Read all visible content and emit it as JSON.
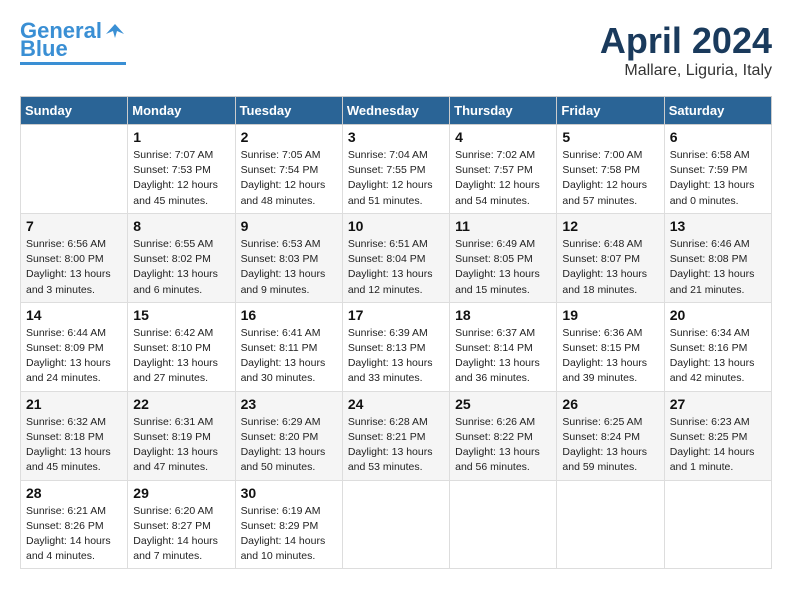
{
  "header": {
    "logo_line1": "General",
    "logo_line2": "Blue",
    "title": "April 2024",
    "subtitle": "Mallare, Liguria, Italy"
  },
  "columns": [
    "Sunday",
    "Monday",
    "Tuesday",
    "Wednesday",
    "Thursday",
    "Friday",
    "Saturday"
  ],
  "weeks": [
    [
      {
        "day": "",
        "info": ""
      },
      {
        "day": "1",
        "info": "Sunrise: 7:07 AM\nSunset: 7:53 PM\nDaylight: 12 hours\nand 45 minutes."
      },
      {
        "day": "2",
        "info": "Sunrise: 7:05 AM\nSunset: 7:54 PM\nDaylight: 12 hours\nand 48 minutes."
      },
      {
        "day": "3",
        "info": "Sunrise: 7:04 AM\nSunset: 7:55 PM\nDaylight: 12 hours\nand 51 minutes."
      },
      {
        "day": "4",
        "info": "Sunrise: 7:02 AM\nSunset: 7:57 PM\nDaylight: 12 hours\nand 54 minutes."
      },
      {
        "day": "5",
        "info": "Sunrise: 7:00 AM\nSunset: 7:58 PM\nDaylight: 12 hours\nand 57 minutes."
      },
      {
        "day": "6",
        "info": "Sunrise: 6:58 AM\nSunset: 7:59 PM\nDaylight: 13 hours\nand 0 minutes."
      }
    ],
    [
      {
        "day": "7",
        "info": "Sunrise: 6:56 AM\nSunset: 8:00 PM\nDaylight: 13 hours\nand 3 minutes."
      },
      {
        "day": "8",
        "info": "Sunrise: 6:55 AM\nSunset: 8:02 PM\nDaylight: 13 hours\nand 6 minutes."
      },
      {
        "day": "9",
        "info": "Sunrise: 6:53 AM\nSunset: 8:03 PM\nDaylight: 13 hours\nand 9 minutes."
      },
      {
        "day": "10",
        "info": "Sunrise: 6:51 AM\nSunset: 8:04 PM\nDaylight: 13 hours\nand 12 minutes."
      },
      {
        "day": "11",
        "info": "Sunrise: 6:49 AM\nSunset: 8:05 PM\nDaylight: 13 hours\nand 15 minutes."
      },
      {
        "day": "12",
        "info": "Sunrise: 6:48 AM\nSunset: 8:07 PM\nDaylight: 13 hours\nand 18 minutes."
      },
      {
        "day": "13",
        "info": "Sunrise: 6:46 AM\nSunset: 8:08 PM\nDaylight: 13 hours\nand 21 minutes."
      }
    ],
    [
      {
        "day": "14",
        "info": "Sunrise: 6:44 AM\nSunset: 8:09 PM\nDaylight: 13 hours\nand 24 minutes."
      },
      {
        "day": "15",
        "info": "Sunrise: 6:42 AM\nSunset: 8:10 PM\nDaylight: 13 hours\nand 27 minutes."
      },
      {
        "day": "16",
        "info": "Sunrise: 6:41 AM\nSunset: 8:11 PM\nDaylight: 13 hours\nand 30 minutes."
      },
      {
        "day": "17",
        "info": "Sunrise: 6:39 AM\nSunset: 8:13 PM\nDaylight: 13 hours\nand 33 minutes."
      },
      {
        "day": "18",
        "info": "Sunrise: 6:37 AM\nSunset: 8:14 PM\nDaylight: 13 hours\nand 36 minutes."
      },
      {
        "day": "19",
        "info": "Sunrise: 6:36 AM\nSunset: 8:15 PM\nDaylight: 13 hours\nand 39 minutes."
      },
      {
        "day": "20",
        "info": "Sunrise: 6:34 AM\nSunset: 8:16 PM\nDaylight: 13 hours\nand 42 minutes."
      }
    ],
    [
      {
        "day": "21",
        "info": "Sunrise: 6:32 AM\nSunset: 8:18 PM\nDaylight: 13 hours\nand 45 minutes."
      },
      {
        "day": "22",
        "info": "Sunrise: 6:31 AM\nSunset: 8:19 PM\nDaylight: 13 hours\nand 47 minutes."
      },
      {
        "day": "23",
        "info": "Sunrise: 6:29 AM\nSunset: 8:20 PM\nDaylight: 13 hours\nand 50 minutes."
      },
      {
        "day": "24",
        "info": "Sunrise: 6:28 AM\nSunset: 8:21 PM\nDaylight: 13 hours\nand 53 minutes."
      },
      {
        "day": "25",
        "info": "Sunrise: 6:26 AM\nSunset: 8:22 PM\nDaylight: 13 hours\nand 56 minutes."
      },
      {
        "day": "26",
        "info": "Sunrise: 6:25 AM\nSunset: 8:24 PM\nDaylight: 13 hours\nand 59 minutes."
      },
      {
        "day": "27",
        "info": "Sunrise: 6:23 AM\nSunset: 8:25 PM\nDaylight: 14 hours\nand 1 minute."
      }
    ],
    [
      {
        "day": "28",
        "info": "Sunrise: 6:21 AM\nSunset: 8:26 PM\nDaylight: 14 hours\nand 4 minutes."
      },
      {
        "day": "29",
        "info": "Sunrise: 6:20 AM\nSunset: 8:27 PM\nDaylight: 14 hours\nand 7 minutes."
      },
      {
        "day": "30",
        "info": "Sunrise: 6:19 AM\nSunset: 8:29 PM\nDaylight: 14 hours\nand 10 minutes."
      },
      {
        "day": "",
        "info": ""
      },
      {
        "day": "",
        "info": ""
      },
      {
        "day": "",
        "info": ""
      },
      {
        "day": "",
        "info": ""
      }
    ]
  ]
}
